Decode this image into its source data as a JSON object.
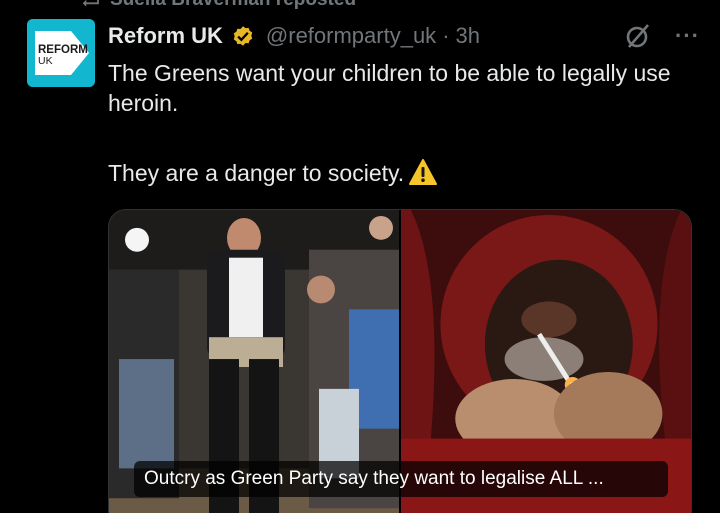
{
  "repost": {
    "label": "Suella Braverman reposted"
  },
  "avatar": {
    "line1": "REFORM",
    "line2": "UK",
    "color": "#12b6cf"
  },
  "header": {
    "name": "Reform UK",
    "handle": "@reformparty_uk",
    "separator": "·",
    "time": "3h",
    "more": "···"
  },
  "tweet": {
    "line1": "The Greens want your children to be able to legally use heroin.",
    "line2": "They are a danger to society."
  },
  "media": {
    "caption": "Outcry as Green Party say they want to legalise ALL ..."
  },
  "colors": {
    "background": "#000000",
    "muted": "#71767b",
    "text": "#e7e9ea",
    "verified": "#e8b824"
  }
}
